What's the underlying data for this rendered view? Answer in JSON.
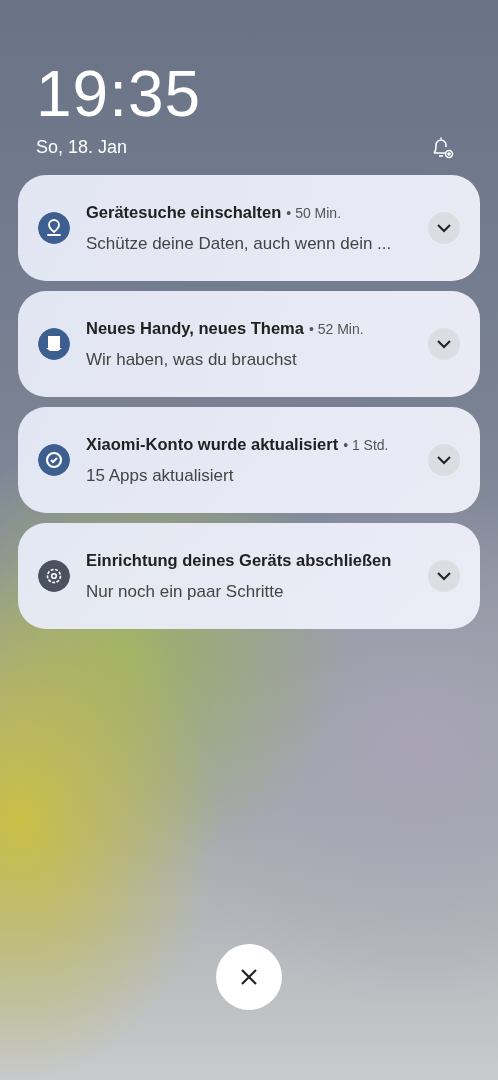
{
  "clock": {
    "time": "19:35",
    "date": "So, 18. Jan"
  },
  "notifications": [
    {
      "kind": "location",
      "title": "Gerätesuche einschalten",
      "age": "• 50 Min.",
      "text": "Schütze deine Daten, auch wenn dein ..."
    },
    {
      "kind": "theme",
      "title": "Neues Handy, neues Thema",
      "age": "• 52 Min.",
      "text": "Wir haben, was du brauchst"
    },
    {
      "kind": "account",
      "title": "Xiaomi-Konto wurde aktualisiert",
      "age": "• 1 Std.",
      "text": "15 Apps aktualisiert"
    },
    {
      "kind": "settings",
      "title": "Einrichtung deines Geräts abschließen",
      "text": "Nur noch ein paar Schritte"
    }
  ]
}
